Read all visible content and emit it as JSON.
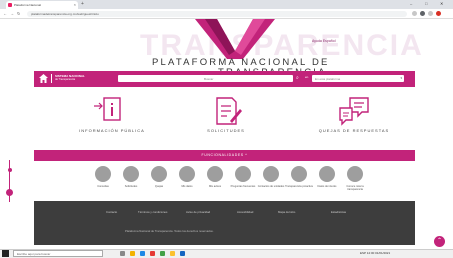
{
  "browser": {
    "tab_title": "Plataforma Nacional",
    "new_tab": "+",
    "url": "plataformadetransparencia.org.mx/web/guest/inicio",
    "window_controls": [
      "–",
      "□",
      "✕"
    ]
  },
  "header": {
    "watermark": "TRANSPARENCIA",
    "title_line1": "PLATAFORMA NACIONAL DE",
    "title_line2": "TRANSPARENCIA",
    "help_link": "Ayuda  Español"
  },
  "bar": {
    "logo_line1": "SISTEMA NACIONAL",
    "logo_line2": "de Transparencia",
    "search_placeholder": "Buscar",
    "select_label": "en",
    "select_value": "En esta plataforma"
  },
  "cards": [
    {
      "label": "INFORMACIÓN PÚBLICA"
    },
    {
      "label": "SOLICITUDES"
    },
    {
      "label": "QUEJAS DE RESPUESTAS"
    }
  ],
  "features_bar": "FUNCIONALIDADES ^",
  "features": [
    {
      "label": "Consultas"
    },
    {
      "label": "Solicitudes"
    },
    {
      "label": "Quejas"
    },
    {
      "label": "Mis datos"
    },
    {
      "label": "Mis avisos"
    },
    {
      "label": "Preguntas frecuentes"
    },
    {
      "label": "Contactos de unidades"
    },
    {
      "label": "Transparencia proactiva"
    },
    {
      "label": "Datos de interés"
    },
    {
      "label": "Conoce más la transparencia"
    }
  ],
  "footer": {
    "links": [
      "Contacto",
      "Términos y condiciones",
      "Aviso de privacidad",
      "Accesibilidad",
      "Mapa del sitio",
      "Estadísticas"
    ],
    "copyright": "Plataforma Nacional de Transparencia. Todos los derechos reservados."
  },
  "taskbar": {
    "search_placeholder": "Escribe aquí para buscar",
    "tray": "ESP  12:00  01/01/2021"
  }
}
